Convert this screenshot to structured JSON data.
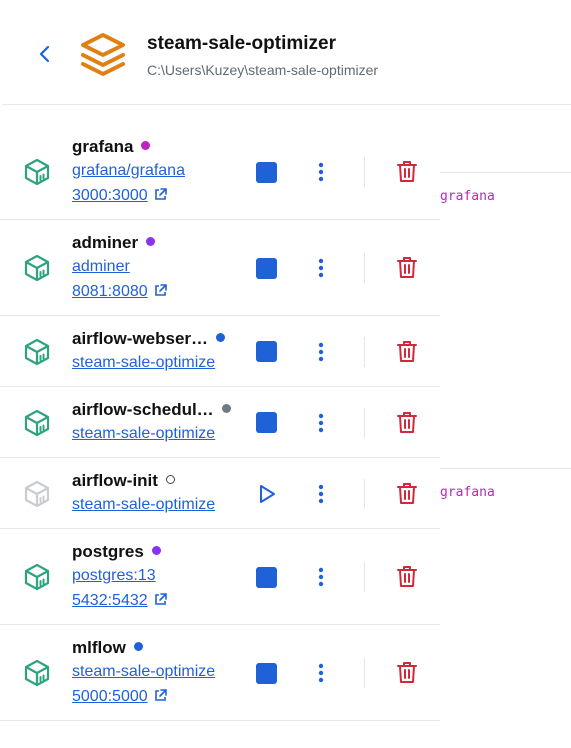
{
  "header": {
    "title": "steam-sale-optimizer",
    "path": "C:\\Users\\Kuzey\\steam-sale-optimizer"
  },
  "background_logs": [
    "grafana",
    "grafana"
  ],
  "colors": {
    "accent": "#1f62d8",
    "running_icon": "#2ea37f",
    "stopped_icon": "#c9cdd1",
    "delete": "#d2283a",
    "logo": "#e07f12"
  },
  "containers": [
    {
      "name": "grafana",
      "status_color": "#c021c0",
      "status": "running",
      "image": "grafana/grafana",
      "port": "3000:3000"
    },
    {
      "name": "adminer",
      "status_color": "#8a33f0",
      "status": "running",
      "image": "adminer",
      "port": "8081:8080"
    },
    {
      "name": "airflow-webser…",
      "status_color": "#1f62d8",
      "status": "running",
      "image": "steam-sale-optimize",
      "port": ""
    },
    {
      "name": "airflow-schedul…",
      "status_color": "#707a84",
      "status": "running",
      "image": "steam-sale-optimize",
      "port": ""
    },
    {
      "name": "airflow-init",
      "status_color": "",
      "status": "exited",
      "image": "steam-sale-optimize",
      "port": ""
    },
    {
      "name": "postgres",
      "status_color": "#8a33f0",
      "status": "running",
      "image": "postgres:13",
      "port": "5432:5432"
    },
    {
      "name": "mlflow",
      "status_color": "#1f62d8",
      "status": "running",
      "image": "steam-sale-optimize",
      "port": "5000:5000"
    }
  ]
}
